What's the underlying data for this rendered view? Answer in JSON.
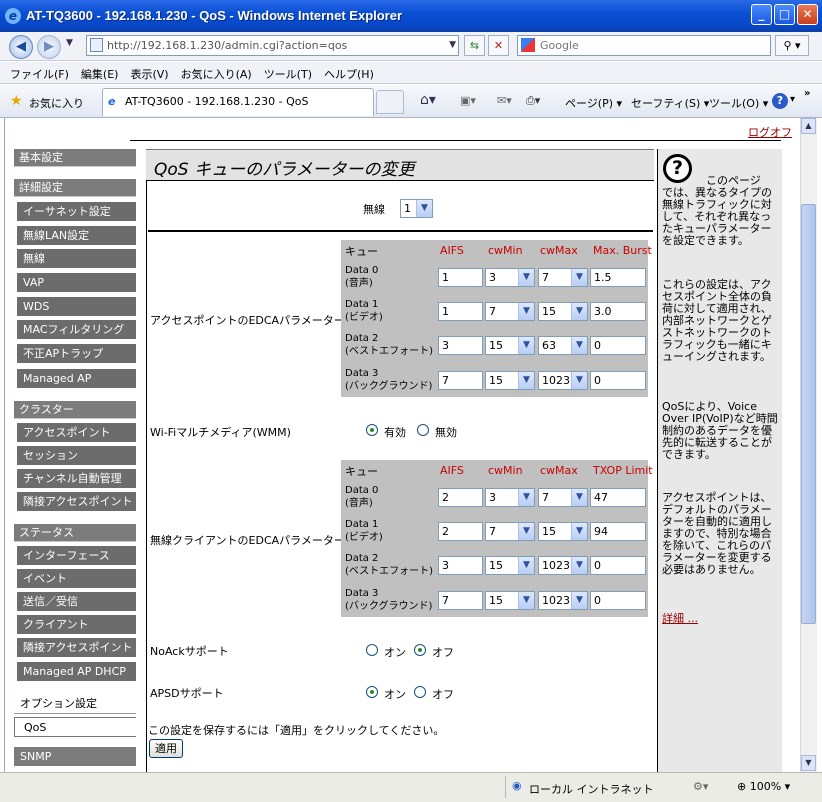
{
  "window": {
    "title": "AT-TQ3600 - 192.168.1.230 - QoS - Windows Internet Explorer"
  },
  "browser": {
    "url": "http://192.168.1.230/admin.cgi?action=qos",
    "search_placeholder": "Google",
    "menu": [
      "ファイル(F)",
      "編集(E)",
      "表示(V)",
      "お気に入り(A)",
      "ツール(T)",
      "ヘルプ(H)"
    ],
    "favorites_label": "お気に入り",
    "tab_title": "AT-TQ3600 - 192.168.1.230 - QoS",
    "cmd_page": "ページ(P)",
    "cmd_safety": "セーフティ(S)",
    "cmd_tools": "ツール(O)"
  },
  "logout": "ログオフ",
  "sidebar": {
    "basic": "基本設定",
    "advanced": "詳細設定",
    "advanced_items": [
      "イーサネット設定",
      "無線LAN設定",
      "無線",
      "VAP",
      "WDS",
      "MACフィルタリング",
      "不正APトラップ",
      "Managed AP"
    ],
    "cluster": "クラスター",
    "cluster_items": [
      "アクセスポイント",
      "セッション",
      "チャンネル自動管理",
      "隣接アクセスポイント"
    ],
    "status": "ステータス",
    "status_items": [
      "インターフェース",
      "イベント",
      "送信／受信",
      "クライアント",
      "隣接アクセスポイント",
      "Managed AP DHCP"
    ],
    "options": "オプション設定",
    "options_selected": "QoS",
    "options_items": [
      "SNMP"
    ]
  },
  "page": {
    "title": "QoS キューのパラメーターの変更",
    "radio_label": "無線",
    "radio_value": "1",
    "ap_edca_label": "アクセスポイントのEDCAパラメーター",
    "ap_headers": [
      "キュー",
      "AIFS",
      "cwMin",
      "cwMax",
      "Max. Burst"
    ],
    "ap_rows": [
      {
        "name": "Data 0",
        "sub": "(音声)",
        "aifs": "1",
        "cwmin": "3",
        "cwmax": "7",
        "burst": "1.5"
      },
      {
        "name": "Data 1",
        "sub": "(ビデオ)",
        "aifs": "1",
        "cwmin": "7",
        "cwmax": "15",
        "burst": "3.0"
      },
      {
        "name": "Data 2",
        "sub": "(ベストエフォート)",
        "aifs": "3",
        "cwmin": "15",
        "cwmax": "63",
        "burst": "0"
      },
      {
        "name": "Data 3",
        "sub": "(バックグラウンド)",
        "aifs": "7",
        "cwmin": "15",
        "cwmax": "1023",
        "burst": "0"
      }
    ],
    "wmm_label": "Wi-Fiマルチメディア(WMM)",
    "wmm_on": "有効",
    "wmm_off": "無効",
    "client_edca_label": "無線クライアントのEDCAパラメーター",
    "client_headers": [
      "キュー",
      "AIFS",
      "cwMin",
      "cwMax",
      "TXOP Limit"
    ],
    "client_rows": [
      {
        "name": "Data 0",
        "sub": "(音声)",
        "aifs": "2",
        "cwmin": "3",
        "cwmax": "7",
        "txop": "47"
      },
      {
        "name": "Data 1",
        "sub": "(ビデオ)",
        "aifs": "2",
        "cwmin": "7",
        "cwmax": "15",
        "txop": "94"
      },
      {
        "name": "Data 2",
        "sub": "(ベストエフォート)",
        "aifs": "3",
        "cwmin": "15",
        "cwmax": "1023",
        "txop": "0"
      },
      {
        "name": "Data 3",
        "sub": "(バックグラウンド)",
        "aifs": "7",
        "cwmin": "15",
        "cwmax": "1023",
        "txop": "0"
      }
    ],
    "noack_label": "NoAckサポート",
    "noack_on": "オン",
    "noack_off": "オフ",
    "apsd_label": "APSDサポート",
    "apsd_on": "オン",
    "apsd_off": "オフ",
    "save_note": "この設定を保存するには「適用」をクリックしてください。",
    "apply_button": "適用"
  },
  "help": {
    "icon": "?",
    "p1_first": "このページ",
    "p1": "では、異なるタイプの無線トラフィックに対して、それぞれ異なったキューパラメーターを設定できます。",
    "p2": "これらの設定は、アクセスポイント全体の負荷に対して適用され、内部ネットワークとゲストネットワークのトラフィックも一緒にキューイングされます。",
    "p3": "QoSにより、Voice Over IP(VoIP)など時間制約のあるデータを優先的に転送することができます。",
    "p4": "アクセスポイントは、デフォルトのパラメーターを自動的に適用しますので、特別な場合を除いて、これらのパラメーターを変更する必要はありません。",
    "more_link": "詳細 ..."
  },
  "status_bar": {
    "zone": "ローカル イントラネット",
    "zoom": "100%"
  }
}
